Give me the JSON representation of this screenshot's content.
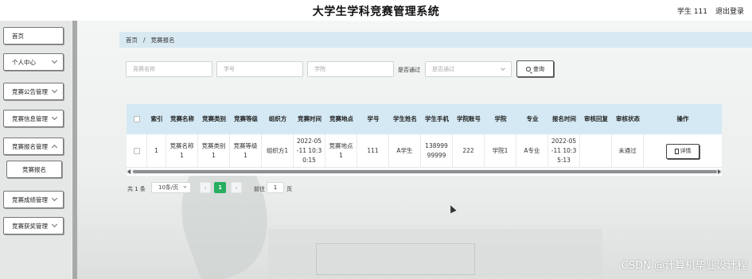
{
  "header": {
    "title": "大学生学科竞赛管理系统",
    "user": "学生 111",
    "logout": "退出登录"
  },
  "sidebar": {
    "items": [
      {
        "label": "首页",
        "expandable": false
      },
      {
        "label": "个人中心",
        "expandable": true
      },
      {
        "label": "竞赛公告管理",
        "expandable": true
      },
      {
        "label": "竞赛信息管理",
        "expandable": true
      },
      {
        "label": "竞赛报名管理",
        "expandable": true
      },
      {
        "label": "竞赛报名",
        "expandable": false,
        "sub": true
      },
      {
        "label": "竞赛成绩管理",
        "expandable": true
      },
      {
        "label": "竞赛获奖管理",
        "expandable": true
      }
    ]
  },
  "breadcrumb": {
    "home": "首页",
    "separator": "/",
    "current": "竞赛报名"
  },
  "filters": {
    "name_placeholder": "竞赛名称",
    "student_no_placeholder": "学号",
    "college_placeholder": "学院",
    "approved_label": "是否通过",
    "approved_placeholder": "是否通过",
    "search_label": "查询"
  },
  "table": {
    "columns": [
      "",
      "索引",
      "竞赛名称",
      "竞赛类别",
      "竞赛等级",
      "组织方",
      "竞赛时间",
      "竞赛地点",
      "学号",
      "学生姓名",
      "学生手机",
      "学院账号",
      "学院",
      "专业",
      "报名时间",
      "审核回复",
      "审核状态",
      "操作"
    ],
    "rows": [
      {
        "index": "1",
        "name": "竞赛名称1",
        "category": "竞赛类别1",
        "level": "竞赛等级1",
        "organizer": "组织方1",
        "time": "2022-05-11 10:30:15",
        "location": "竞赛地点1",
        "student_no": "111",
        "student_name": "A学生",
        "phone": "13899999999",
        "college_account": "222",
        "college": "学院1",
        "major": "A专业",
        "signup_time": "2022-05-11 10:35:13",
        "reply": "",
        "status": "未通过",
        "action": "详情"
      }
    ]
  },
  "pagination": {
    "total": "共 1 条",
    "page_size": "10条/页",
    "prev": "‹",
    "current": "1",
    "next": "›",
    "goto_label": "前往",
    "goto_value": "1",
    "page_suffix": "页"
  },
  "watermark": "CSDN @计算机毕业设计程",
  "colors": {
    "accent": "#27ae60",
    "header_bg": "#d5e9f4",
    "breadcrumb_bg": "#d9e9f2"
  }
}
